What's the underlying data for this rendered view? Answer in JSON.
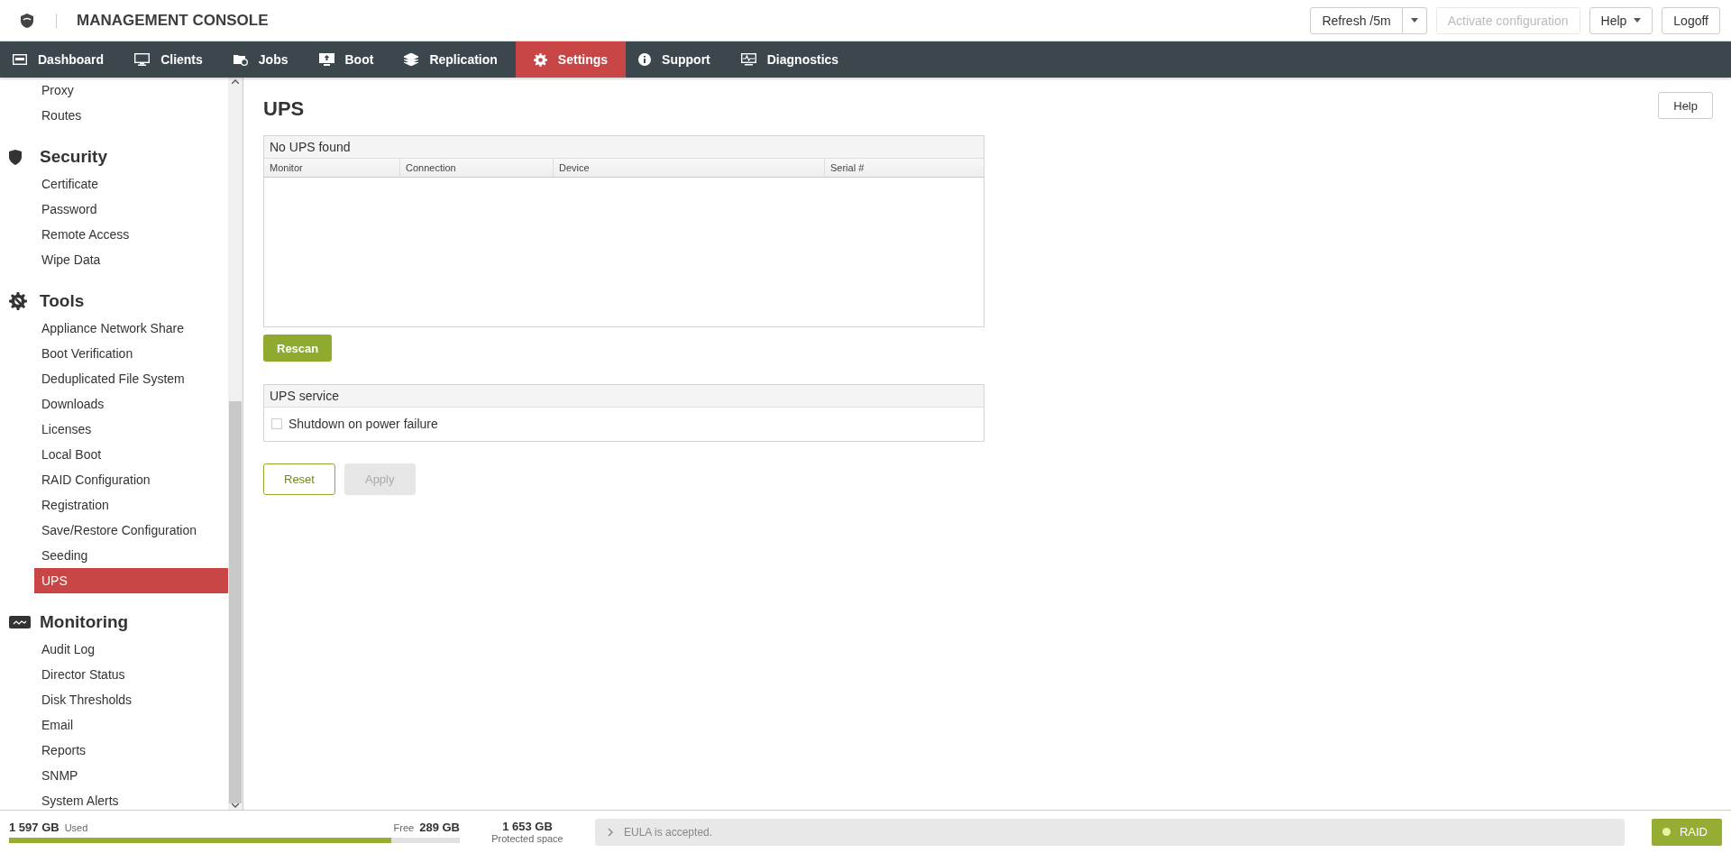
{
  "header": {
    "title": "MANAGEMENT CONSOLE",
    "buttons": [
      {
        "label": "Refresh /5m",
        "kind": "split",
        "disabled": false
      },
      {
        "label": "Activate configuration",
        "kind": "plain",
        "disabled": true
      },
      {
        "label": "Help",
        "kind": "dropdown",
        "disabled": false
      },
      {
        "label": "Logoff",
        "kind": "plain",
        "disabled": false
      }
    ]
  },
  "nav": [
    {
      "label": "Dashboard",
      "selected": false
    },
    {
      "label": "Clients",
      "selected": false
    },
    {
      "label": "Jobs",
      "selected": false
    },
    {
      "label": "Boot",
      "selected": false
    },
    {
      "label": "Replication",
      "selected": false
    },
    {
      "label": "Settings",
      "selected": true
    },
    {
      "label": "Support",
      "selected": false
    },
    {
      "label": "Diagnostics",
      "selected": false
    }
  ],
  "sidebar": {
    "sections": [
      {
        "items": [
          {
            "label": "Proxy",
            "selected": false
          },
          {
            "label": "Routes",
            "selected": false
          }
        ]
      },
      {
        "title": "Security",
        "items": [
          {
            "label": "Certificate",
            "selected": false
          },
          {
            "label": "Password",
            "selected": false
          },
          {
            "label": "Remote Access",
            "selected": false
          },
          {
            "label": "Wipe Data",
            "selected": false
          }
        ]
      },
      {
        "title": "Tools",
        "items": [
          {
            "label": "Appliance Network Share",
            "selected": false
          },
          {
            "label": "Boot Verification",
            "selected": false
          },
          {
            "label": "Deduplicated File System",
            "selected": false
          },
          {
            "label": "Downloads",
            "selected": false
          },
          {
            "label": "Licenses",
            "selected": false
          },
          {
            "label": "Local Boot",
            "selected": false
          },
          {
            "label": "RAID Configuration",
            "selected": false
          },
          {
            "label": "Registration",
            "selected": false
          },
          {
            "label": "Save/Restore Configuration",
            "selected": false
          },
          {
            "label": "Seeding",
            "selected": false
          },
          {
            "label": "UPS",
            "selected": true
          }
        ]
      },
      {
        "title": "Monitoring",
        "items": [
          {
            "label": "Audit Log",
            "selected": false
          },
          {
            "label": "Director Status",
            "selected": false
          },
          {
            "label": "Disk Thresholds",
            "selected": false
          },
          {
            "label": "Email",
            "selected": false
          },
          {
            "label": "Reports",
            "selected": false
          },
          {
            "label": "SNMP",
            "selected": false
          },
          {
            "label": "System Alerts",
            "selected": false
          }
        ]
      }
    ]
  },
  "main": {
    "title": "UPS",
    "help": "Help",
    "table": {
      "caption": "No UPS found",
      "columns": [
        "Monitor",
        "Connection",
        "Device",
        "Serial #"
      ]
    },
    "rescan": "Rescan",
    "service": {
      "title": "UPS service",
      "option": {
        "label": "Shutdown on power failure",
        "checked": false
      }
    },
    "actions": [
      {
        "label": "Reset",
        "kind": "outline",
        "disabled": false
      },
      {
        "label": "Apply",
        "kind": "filled",
        "disabled": true
      }
    ]
  },
  "status_bar": {
    "used": "1 597 GB",
    "used_label": "Used",
    "free_label": "Free",
    "free": "289 GB",
    "level": 0.847,
    "protected": "1 653 GB",
    "protected_label": "Protected space",
    "message": "EULA is accepted.",
    "raid": "RAID"
  }
}
